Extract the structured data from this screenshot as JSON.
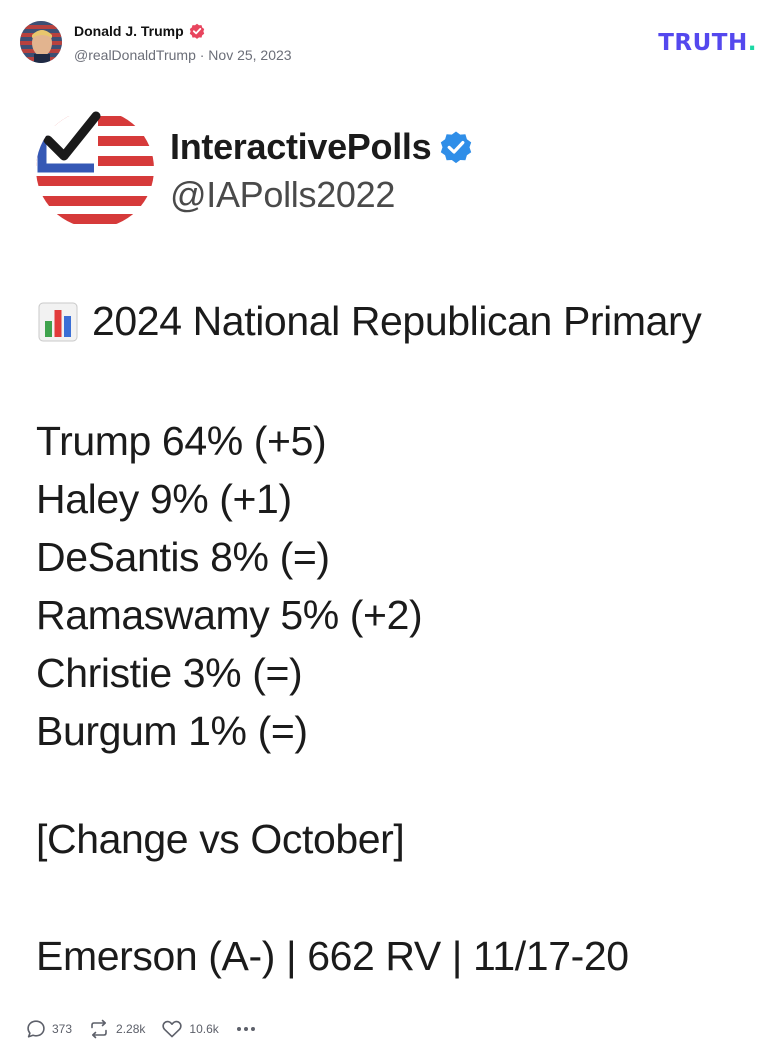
{
  "post": {
    "author_name": "Donald J. Trump",
    "author_meta": "@realDonaldTrump · Nov 25, 2023",
    "brand_logo_text": "TRUTH",
    "brand_logo_dot": ".",
    "brand_color": "#5448ee",
    "brand_dot_color": "#1bd8a4"
  },
  "image": {
    "account_name": "InteractivePolls",
    "account_handle": "@IAPolls2022",
    "title": "2024 National Republican Primary",
    "title_icon": "bar-chart-icon",
    "results": [
      "Trump 64% (+5)",
      "Haley 9% (+1)",
      "DeSantis 8% (=)",
      "Ramaswamy 5% (+2)",
      "Christie 3% (=)",
      "Burgum 1% (=)"
    ],
    "note": "[Change vs October]",
    "source": "Emerson (A-) | 662 RV | 11/17-20"
  },
  "actions": {
    "replies": "373",
    "retruths": "2.28k",
    "likes": "10.6k"
  },
  "icons": {
    "reply": "comment-icon",
    "retruth": "repost-icon",
    "like": "heart-icon",
    "more": "more-icon",
    "verified": "verified-badge-icon"
  }
}
